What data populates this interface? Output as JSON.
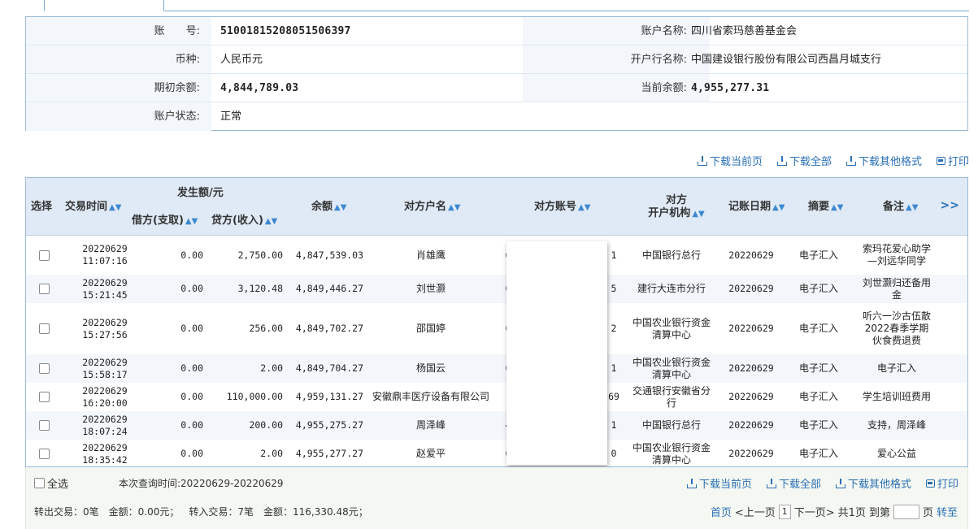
{
  "account": {
    "acct_no_label": "账　　号:",
    "acct_no": "51001815208051506397",
    "acct_name_label": "账户名称:",
    "acct_name": "四川省索玛慈善基金会",
    "currency_label": "币种:",
    "currency": "人民币元",
    "bank_label": "开户行名称:",
    "bank": "中国建设银行股份有限公司西昌月城支行",
    "open_bal_label": "期初余额:",
    "open_bal": "4,844,789.03",
    "cur_bal_label": "当前余额:",
    "cur_bal": "4,955,277.31",
    "status_label": "账户状态:",
    "status": "正常"
  },
  "links": {
    "dl_page": "下载当前页",
    "dl_all": "下载全部",
    "dl_other": "下载其他格式",
    "print": "打印"
  },
  "columns": {
    "select": "选择",
    "time": "交易时间",
    "amount_group": "发生额/元",
    "debit": "借方(支取)",
    "credit": "贷方(收入)",
    "balance": "余额",
    "payee": "对方户名",
    "payee_acct": "对方账号",
    "payee_bank_l1": "对方",
    "payee_bank_l2": "开户机构",
    "book_date": "记账日期",
    "summary": "摘要",
    "remark": "备注",
    "more": ">>",
    "sort_glyph": "▲▼"
  },
  "rows": [
    {
      "date": "20220629",
      "time": "11:07:16",
      "debit": "0.00",
      "credit": "2,750.00",
      "balance": "4,847,539.03",
      "payee": "肖雄鹰",
      "acct_head": "6",
      "acct_tail": "1",
      "bank": "中国银行总行",
      "book_date": "20220629",
      "summary": "电子汇入",
      "remark": "索玛花爱心助学—刘远华同学"
    },
    {
      "date": "20220629",
      "time": "15:21:45",
      "debit": "0.00",
      "credit": "3,120.48",
      "balance": "4,849,446.27",
      "payee": "刘世灏",
      "acct_head": "6",
      "acct_tail": "5",
      "bank": "建行大连市分行",
      "book_date": "20220629",
      "summary": "电子汇入",
      "remark": "刘世灏归还备用金"
    },
    {
      "date": "20220629",
      "time": "15:27:56",
      "debit": "0.00",
      "credit": "256.00",
      "balance": "4,849,702.27",
      "payee": "邵国婷",
      "acct_head": "6",
      "acct_tail": "2",
      "bank": "中国农业银行资金清算中心",
      "book_date": "20220629",
      "summary": "电子汇入",
      "remark": "听六一沙古伍散2022春季学期伙食费退费"
    },
    {
      "date": "20220629",
      "time": "15:58:17",
      "debit": "0.00",
      "credit": "2.00",
      "balance": "4,849,704.27",
      "payee": "杨国云",
      "acct_head": "6",
      "acct_tail": "1",
      "bank": "中国农业银行资金清算中心",
      "book_date": "20220629",
      "summary": "电子汇入",
      "remark": "电子汇入"
    },
    {
      "date": "20220629",
      "time": "16:20:00",
      "debit": "0.00",
      "credit": "110,000.00",
      "balance": "4,959,131.27",
      "payee": "安徽鼎丰医疗设备有限公司",
      "acct_head": "",
      "acct_tail": "69",
      "bank": "交通银行安徽省分行",
      "book_date": "20220629",
      "summary": "电子汇入",
      "remark": "学生培训班费用"
    },
    {
      "date": "20220629",
      "time": "18:07:24",
      "debit": "0.00",
      "credit": "200.00",
      "balance": "4,955,275.27",
      "payee": "周泽峰",
      "acct_head": "4",
      "acct_tail": "1",
      "bank": "中国银行总行",
      "book_date": "20220629",
      "summary": "电子汇入",
      "remark": "支持，周泽峰"
    },
    {
      "date": "20220629",
      "time": "18:35:42",
      "debit": "0.00",
      "credit": "2.00",
      "balance": "4,955,277.27",
      "payee": "赵爱平",
      "acct_head": "6",
      "acct_tail": "0",
      "bank": "中国农业银行资金清算中心",
      "book_date": "20220629",
      "summary": "电子汇入",
      "remark": "爱心公益"
    }
  ],
  "footer": {
    "select_all": "全选",
    "query_time": "本次查询时间:20220629-20220629",
    "out_count": "转出交易：0笔",
    "out_amount": "金额：0.00元；",
    "in_count": "转入交易：7笔",
    "in_amount": "金额：116,330.48元；",
    "first": "首页",
    "prev": "<上一页",
    "page": "1",
    "next": "下一页>",
    "total": "共1页",
    "goto": "到第",
    "page_unit": "页",
    "go": "转至"
  },
  "colors": {
    "header_bg": "#dfeaf6",
    "link": "#2a6fb5",
    "alt_row": "#f3f7fb"
  }
}
